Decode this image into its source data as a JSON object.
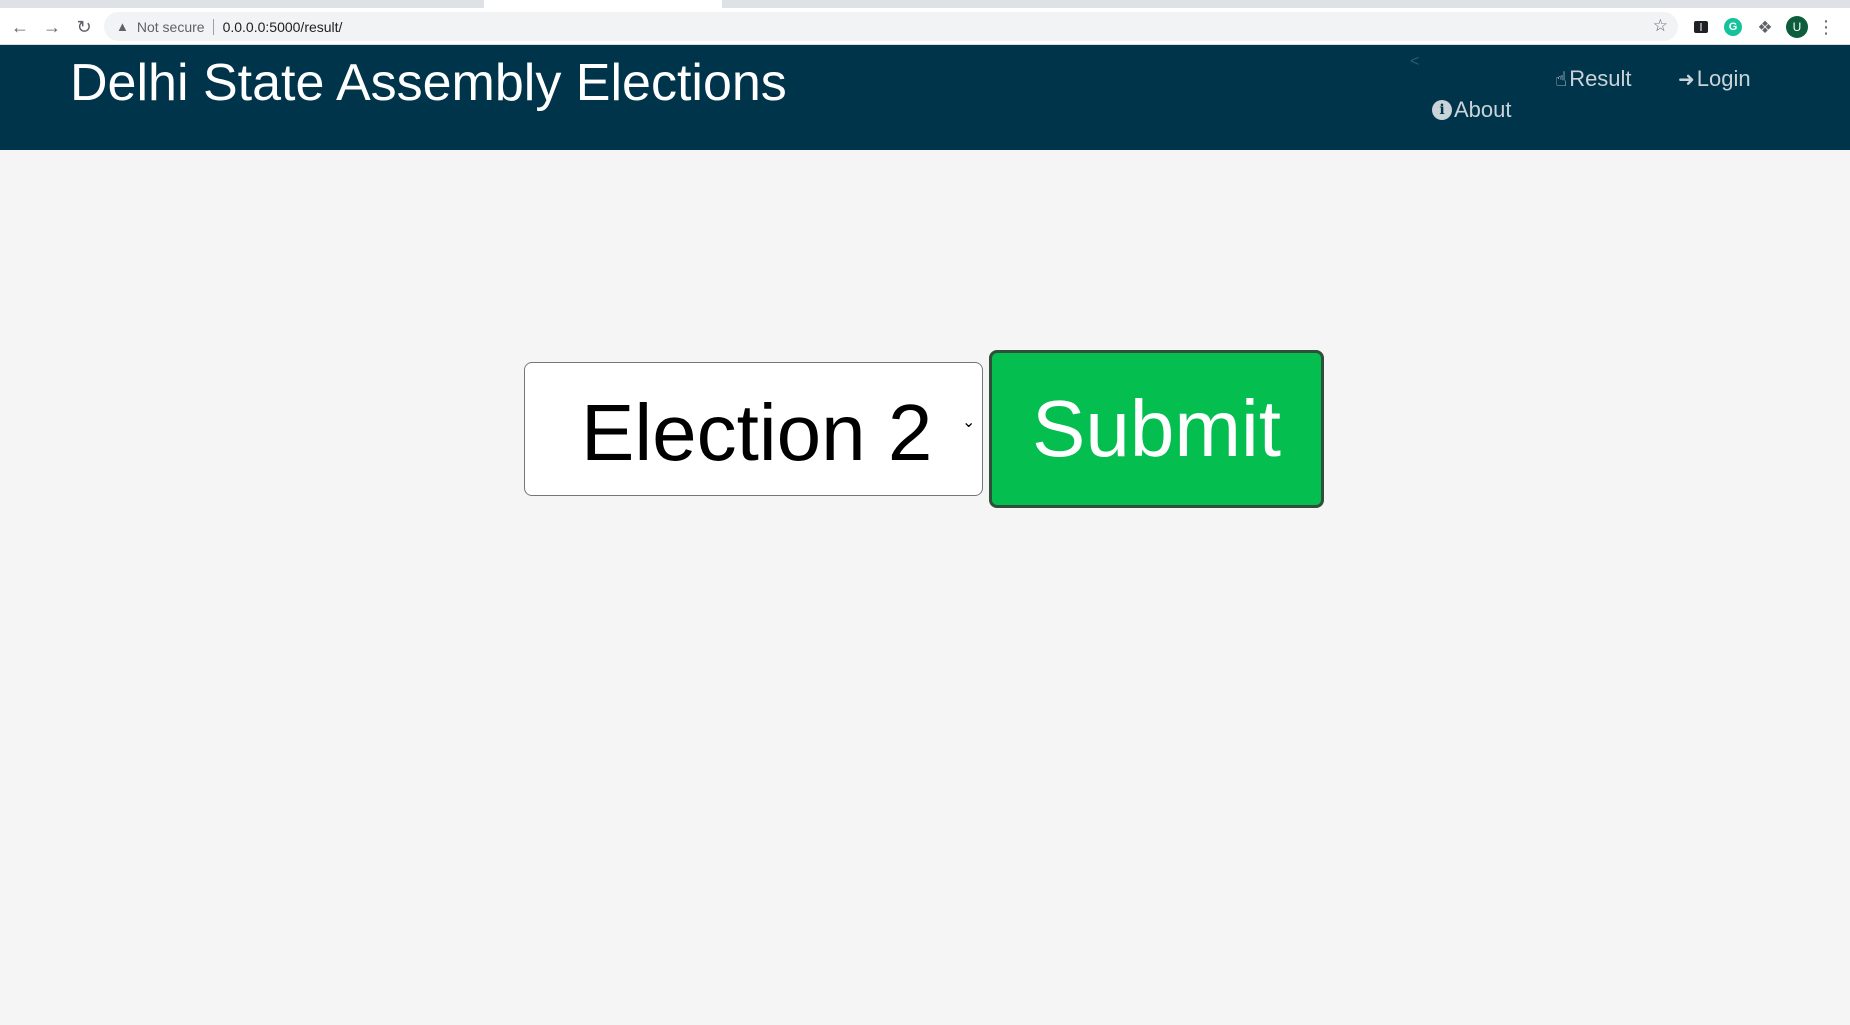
{
  "browser": {
    "address_warning": "Not secure",
    "url": "0.0.0.0:5000/result/",
    "avatar_initial": "U",
    "icons": {
      "back": "back-arrow-icon",
      "forward": "forward-arrow-icon",
      "reload": "reload-icon",
      "warning": "warning-icon",
      "bookmark": "star-icon",
      "extension_tab": "tab-extension-icon",
      "extension_grammarly": "grammarly-icon",
      "extensions": "puzzle-icon",
      "menu": "kebab-menu-icon"
    }
  },
  "header": {
    "title": "Delhi State Assembly Elections",
    "background_color": "#00344b",
    "nav": {
      "result": "Result",
      "login": "Login",
      "about": "About"
    }
  },
  "form": {
    "election_select": {
      "selected": "Election 2"
    },
    "submit_label": "Submit",
    "submit_color": "#04bf4f"
  }
}
